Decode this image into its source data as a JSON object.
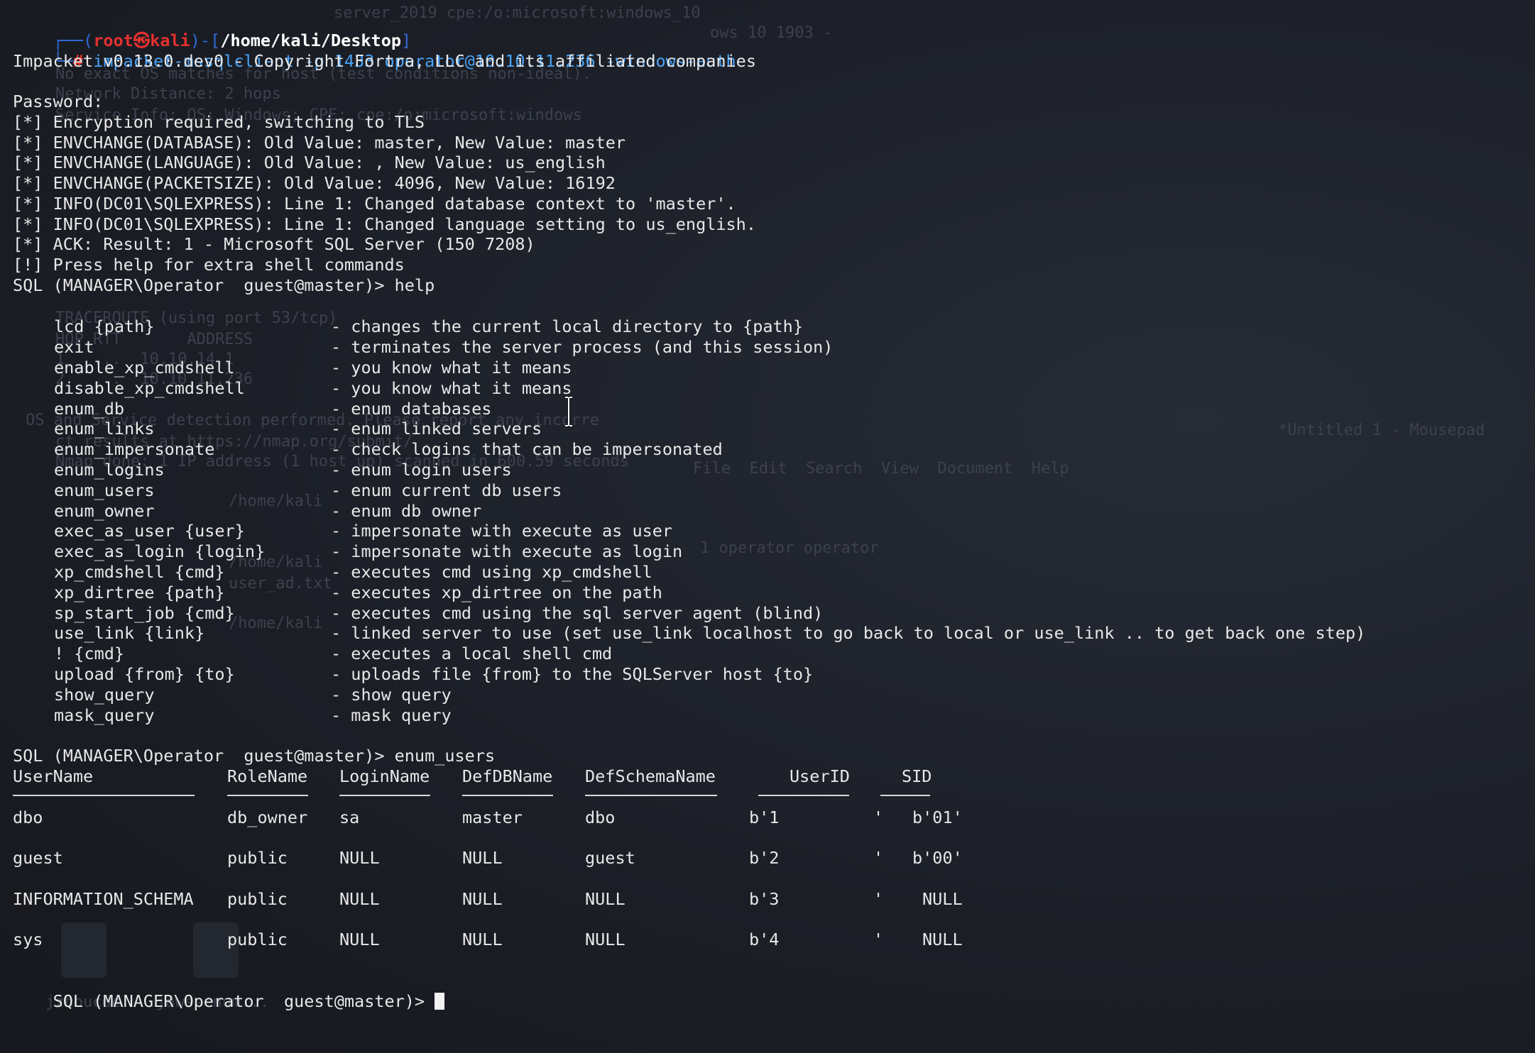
{
  "prompt": {
    "corner": "┌──(",
    "user": "root",
    "at": "㉿",
    "host": "kali",
    "sep": ")-[",
    "cwd": "/home/kali/Desktop",
    "close": "]",
    "second_corner": "└─",
    "hash": "#",
    "command": "impacket-mssqlclient -p 1433 operator@10.10.11.236 -windows-auth"
  },
  "output_lines": [
    "Impacket v0.13.0.dev0 - Copyright Fortra, LLC and its affiliated companies",
    "",
    "Password:",
    "[*] Encryption required, switching to TLS",
    "[*] ENVCHANGE(DATABASE): Old Value: master, New Value: master",
    "[*] ENVCHANGE(LANGUAGE): Old Value: , New Value: us_english",
    "[*] ENVCHANGE(PACKETSIZE): Old Value: 4096, New Value: 16192",
    "[*] INFO(DC01\\SQLEXPRESS): Line 1: Changed database context to 'master'.",
    "[*] INFO(DC01\\SQLEXPRESS): Line 1: Changed language setting to us_english.",
    "[*] ACK: Result: 1 - Microsoft SQL Server (150 7208)",
    "[!] Press help for extra shell commands",
    "SQL (MANAGER\\Operator  guest@master)> help"
  ],
  "help_items": [
    {
      "cmd": "lcd {path}",
      "desc": "- changes the current local directory to {path}"
    },
    {
      "cmd": "exit",
      "desc": "- terminates the server process (and this session)"
    },
    {
      "cmd": "enable_xp_cmdshell",
      "desc": "- you know what it means"
    },
    {
      "cmd": "disable_xp_cmdshell",
      "desc": "- you know what it means"
    },
    {
      "cmd": "enum_db",
      "desc": "- enum databases"
    },
    {
      "cmd": "enum_links",
      "desc": "- enum linked servers"
    },
    {
      "cmd": "enum_impersonate",
      "desc": "- check logins that can be impersonated"
    },
    {
      "cmd": "enum_logins",
      "desc": "- enum login users"
    },
    {
      "cmd": "enum_users",
      "desc": "- enum current db users"
    },
    {
      "cmd": "enum_owner",
      "desc": "- enum db owner"
    },
    {
      "cmd": "exec_as_user {user}",
      "desc": "- impersonate with execute as user"
    },
    {
      "cmd": "exec_as_login {login}",
      "desc": "- impersonate with execute as login"
    },
    {
      "cmd": "xp_cmdshell {cmd}",
      "desc": "- executes cmd using xp_cmdshell"
    },
    {
      "cmd": "xp_dirtree {path}",
      "desc": "- executes xp_dirtree on the path"
    },
    {
      "cmd": "sp_start_job {cmd}",
      "desc": "- executes cmd using the sql server agent (blind)"
    },
    {
      "cmd": "use_link {link}",
      "desc": "- linked server to use (set use_link localhost to go back to local or use_link .. to get back one step)"
    },
    {
      "cmd": "! {cmd}",
      "desc": "- executes a local shell cmd"
    },
    {
      "cmd": "upload {from} {to}",
      "desc": "- uploads file {from} to the SQLServer host {to}"
    },
    {
      "cmd": "show_query",
      "desc": "- show query"
    },
    {
      "cmd": "mask_query",
      "desc": "- mask query"
    }
  ],
  "enum_prompt": "SQL (MANAGER\\Operator  guest@master)> enum_users",
  "table": {
    "headers": [
      "UserName",
      "RoleName",
      "LoginName",
      "DefDBName",
      "DefSchemaName",
      "UserID",
      "SID"
    ],
    "rows": [
      [
        "dbo",
        "db_owner",
        "sa",
        "master",
        "dbo",
        "b'1",
        "'",
        "b'01'"
      ],
      [
        "guest",
        "public",
        "NULL",
        "NULL",
        "guest",
        "b'2",
        "'",
        "b'00'"
      ],
      [
        "INFORMATION_SCHEMA",
        "public",
        "NULL",
        "NULL",
        "NULL",
        "b'3",
        "'",
        "NULL"
      ],
      [
        "sys",
        "public",
        "NULL",
        "NULL",
        "NULL",
        "b'4",
        "'",
        "NULL"
      ]
    ]
  },
  "final_prompt": "SQL (MANAGER\\Operator  guest@master)> ",
  "background_text": [
    "server_2019 cpe:/o:microsoft:windows_10",
    "ows 10 1903 -",
    "No exact OS matches for host (test conditions non-ideal).",
    "Network Distance: 2 hops",
    "Service Info: OS: Windows; CPE: cpe:/o:microsoft:windows",
    "TRACEROUTE (using port 53/tcp)",
    "HOP RTT       ADDRESS",
    "1   ...  10.10.14.1",
    "2   ...  10.10.11.236",
    "OS and Service detection performed. Please report any incorre",
    "ct results at https://nmap.org/submit/ .",
    "Nmap done: 1 IP address (1 host up) scanned in 600.59 seconds",
    "/home/kali",
    "/home/kali",
    "user_ad.txt",
    "/home/kali",
    "*Untitled 1 - Mousepad",
    "File  Edit  Search  View  Document  Help",
    "1 operator operator",
    "jzhoucdc",
    "jaws-enum..."
  ],
  "colors": {
    "prompt_bracket": "#2f6bd8",
    "root_user": "#e3312f",
    "command": "#49a3f7",
    "text": "#e8e8e8",
    "background": "#1b1e26"
  }
}
